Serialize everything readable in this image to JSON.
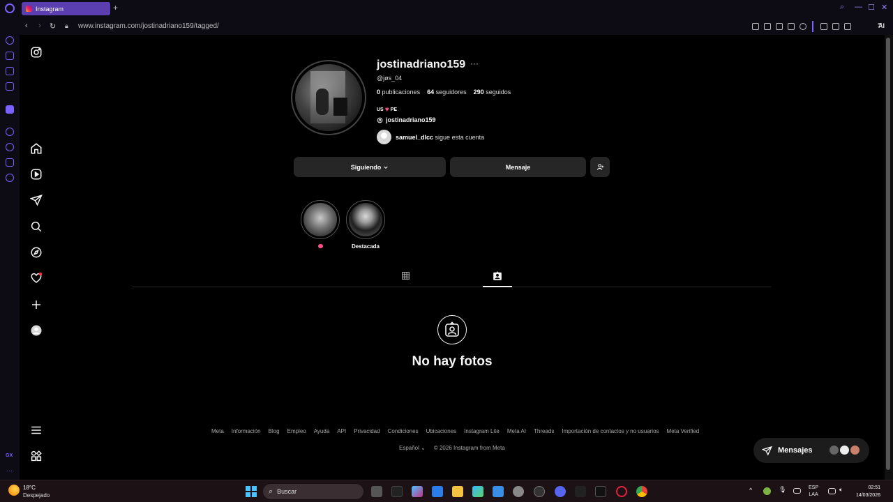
{
  "browser": {
    "tab_title": "Instagram",
    "new_tab": "+",
    "url": "www.instagram.com/jostinadriano159/tagged/",
    "ai_label": "AI",
    "gx_label": "GX"
  },
  "profile": {
    "username": "jostinadriano159",
    "more": "···",
    "handle": "@jøs_04",
    "stats": {
      "posts_count": "0",
      "posts_label": "publicaciones",
      "followers_count": "64",
      "followers_label": "seguidores",
      "following_count": "290",
      "following_label": "seguidos"
    },
    "bio": {
      "left": "US",
      "heart": "♥",
      "right": "PE"
    },
    "threads_handle": "jostinadriano159",
    "followed_by_user": "samuel_dlcc",
    "followed_by_text": "sigue esta cuenta"
  },
  "actions": {
    "following": "Siguiendo",
    "message": "Mensaje"
  },
  "highlights": [
    {
      "label": ""
    },
    {
      "label": "Destacada"
    }
  ],
  "empty_state": {
    "title": "No hay fotos"
  },
  "footer": {
    "links": [
      "Meta",
      "Información",
      "Blog",
      "Empleo",
      "Ayuda",
      "API",
      "Privacidad",
      "Condiciones",
      "Ubicaciones",
      "Instagram Lite",
      "Meta AI",
      "Threads",
      "Importación de contactos y no usuarios",
      "Meta Verified"
    ],
    "language": "Español",
    "copyright": "© 2026 Instagram from Meta"
  },
  "messages_button": {
    "label": "Mensajes"
  },
  "taskbar": {
    "weather_temp": "18°C",
    "weather_desc": "Despejado",
    "search_placeholder": "Buscar",
    "lang_top": "ESP",
    "lang_bottom": "LAA",
    "time": "02:51",
    "date": "14/03/2026"
  },
  "colors": {
    "accent": "#7b61ff",
    "tab_active": "#5b3fb0",
    "button_bg": "#262626",
    "heart": "#ff4f8b"
  }
}
